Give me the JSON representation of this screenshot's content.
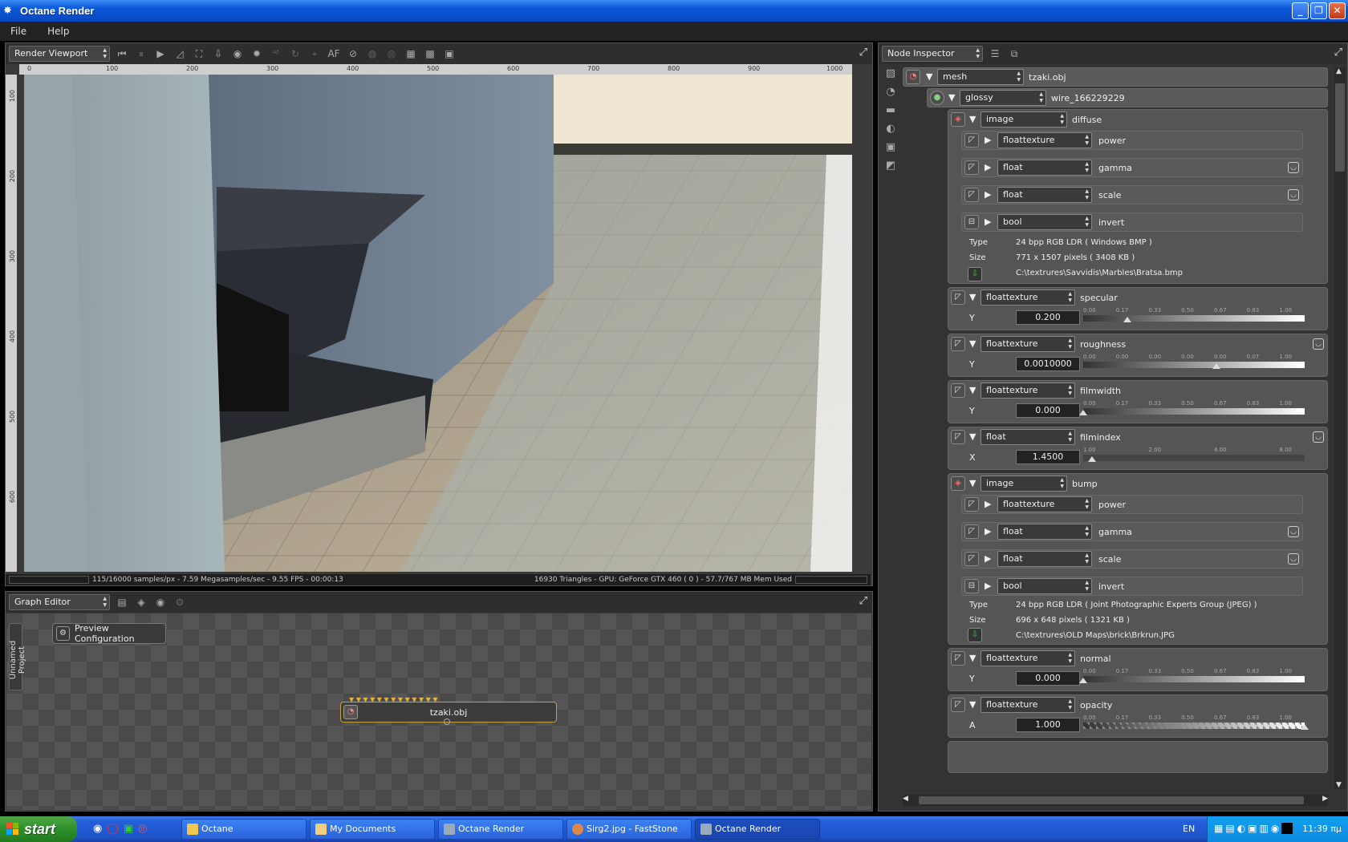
{
  "window": {
    "title": "Octane Render"
  },
  "menu": {
    "file": "File",
    "help": "Help"
  },
  "viewport": {
    "selector": "Render Viewport",
    "af_label": "AF",
    "ruler_x": [
      "0",
      "100",
      "200",
      "300",
      "400",
      "500",
      "600",
      "700",
      "800",
      "900",
      "1000"
    ],
    "ruler_y": [
      "100",
      "200",
      "300",
      "400",
      "500",
      "600"
    ],
    "status_left": "115/16000 samples/px - 7.59 Megasamples/sec - 9.55 FPS - 00:00:13",
    "status_right": "16930 Triangles - GPU: GeForce GTX 460 ( 0 ) - 57.7/767 MB Mem Used"
  },
  "graph": {
    "selector": "Graph Editor",
    "tab_label": "Unnamed Project",
    "preview_btn": "Preview Configuration",
    "node_label": "tzaki.obj"
  },
  "inspector": {
    "selector": "Node Inspector",
    "mesh": {
      "type": "mesh",
      "name": "tzaki.obj"
    },
    "material": {
      "type": "glossy",
      "name": "wire_166229229"
    },
    "diffuse": {
      "type": "image",
      "name": "diffuse",
      "power": {
        "type": "floattexture",
        "name": "power"
      },
      "gamma": {
        "type": "float",
        "name": "gamma"
      },
      "scale": {
        "type": "float",
        "name": "scale"
      },
      "invert": {
        "type": "bool",
        "name": "invert"
      },
      "type_label": "Type",
      "type_value": "24 bpp RGB LDR ( Windows BMP )",
      "size_label": "Size",
      "size_value": "771 x 1507 pixels ( 3408 KB )",
      "path": "C:\\textrures\\Savvidis\\Marbles\\Bratsa.bmp"
    },
    "specular": {
      "type": "floattexture",
      "name": "specular",
      "axis": "Y",
      "value": "0.200",
      "ticks": [
        "0.00",
        "0.17",
        "0.33",
        "0.50",
        "0.67",
        "0.83",
        "1.00"
      ],
      "level": 0.2
    },
    "roughness": {
      "type": "floattexture",
      "name": "roughness",
      "axis": "Y",
      "value": "0.0010000",
      "ticks": [
        "0.00",
        "0.00",
        "0.00",
        "0.00",
        "0.00",
        "0.07",
        "1.00"
      ],
      "level": 0.6
    },
    "filmwidth": {
      "type": "floattexture",
      "name": "filmwidth",
      "axis": "Y",
      "value": "0.000",
      "ticks": [
        "0.00",
        "0.17",
        "0.33",
        "0.50",
        "0.67",
        "0.83",
        "1.00"
      ],
      "level": 0.0
    },
    "filmindex": {
      "type": "float",
      "name": "filmindex",
      "axis": "X",
      "value": "1.4500",
      "ticks": [
        "1.00",
        "2.00",
        "4.00",
        "8.00"
      ],
      "level": 0.04
    },
    "bump": {
      "type": "image",
      "name": "bump",
      "power": {
        "type": "floattexture",
        "name": "power"
      },
      "gamma": {
        "type": "float",
        "name": "gamma"
      },
      "scale": {
        "type": "float",
        "name": "scale"
      },
      "invert": {
        "type": "bool",
        "name": "invert"
      },
      "type_label": "Type",
      "type_value": "24 bpp RGB LDR ( Joint Photographic Experts Group (JPEG) )",
      "size_label": "Size",
      "size_value": "696 x 648 pixels ( 1321 KB )",
      "path": "C:\\textrures\\OLD Maps\\brick\\Brkrun.JPG"
    },
    "normal": {
      "type": "floattexture",
      "name": "normal",
      "axis": "Y",
      "value": "0.000",
      "ticks": [
        "0.00",
        "0.17",
        "0.33",
        "0.50",
        "0.67",
        "0.83",
        "1.00"
      ],
      "level": 0.0
    },
    "opacity": {
      "type": "floattexture",
      "name": "opacity",
      "axis": "A",
      "value": "1.000",
      "ticks": [
        "0.00",
        "0.17",
        "0.33",
        "0.50",
        "0.67",
        "0.83",
        "1.00"
      ],
      "level": 1.0
    }
  },
  "taskbar": {
    "start": "start",
    "items": [
      "Octane",
      "My Documents",
      "Octane Render",
      "Sirg2.jpg - FastStone",
      "Octane Render"
    ],
    "lang": "EN",
    "clock": "11:39 πμ"
  },
  "colors": {
    "titlebar": "#0a56d8",
    "panel": "#3a3a3a",
    "accent": "#e0b040"
  }
}
